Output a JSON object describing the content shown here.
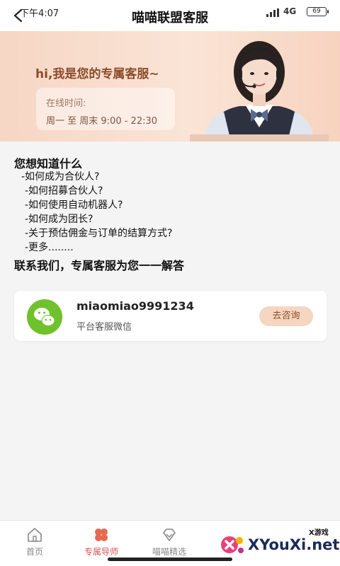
{
  "status": {
    "time": "下午4:07",
    "network": "4G",
    "battery": "69"
  },
  "header": {
    "title": "喵喵联盟客服"
  },
  "banner": {
    "greeting": "hi,我是您的专属客服~",
    "hours_label": "在线时间:",
    "hours_value": "周一 至 周末 9:00 - 22:30"
  },
  "faq": {
    "title": "您想知道什么",
    "items": [
      "-如何成为合伙人?",
      "-如何招募合伙人?",
      "-如何使用自动机器人?",
      "-如何成为团长?",
      "-关于预估佣金与订单的结算方式?",
      "-更多........"
    ],
    "footer": "联系我们，专属客服为您一一解答"
  },
  "contact": {
    "wechat_id": "miaomiao9991234",
    "description": "平台客服微信",
    "button_label": "去咨询"
  },
  "tabs": [
    {
      "label": "首页",
      "icon": "home-icon",
      "active": false
    },
    {
      "label": "专属导师",
      "icon": "clover-icon",
      "active": true
    },
    {
      "label": "喵喵精选",
      "icon": "diamond-icon",
      "active": false
    }
  ],
  "watermark": {
    "small": "X游戏",
    "main": "XYouXi.net"
  },
  "colors": {
    "accent": "#d9534f",
    "banner_text": "#8b4b2a",
    "wechat_green": "#6fc22b",
    "button_bg": "#f6d6c0"
  }
}
